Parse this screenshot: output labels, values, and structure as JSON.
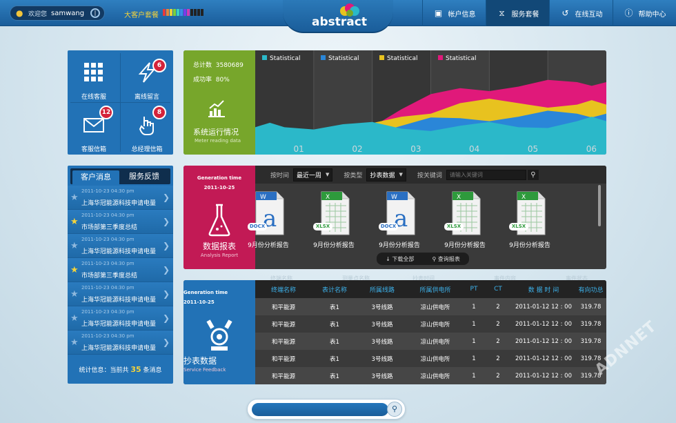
{
  "topbar": {
    "welcome": "欢迎您",
    "username": "samwang",
    "package_label": "大客户套餐",
    "package_level_colors": [
      "#e83a3a",
      "#e8893a",
      "#e8d33a",
      "#7bd13a",
      "#3ad1c1",
      "#3a8ce8",
      "#7b3ae8",
      "#d13ab4",
      "#222222",
      "#222222",
      "#222222",
      "#222222"
    ],
    "logo": "abstract",
    "nav": [
      {
        "label": "帐户信息",
        "icon": "chat-icon"
      },
      {
        "label": "服务套餐",
        "icon": "rss-icon"
      },
      {
        "label": "在线互动",
        "icon": "history-icon"
      },
      {
        "label": "帮助中心",
        "icon": "info-icon"
      }
    ]
  },
  "tiles": [
    {
      "label": "在线客服",
      "icon": "grid-icon",
      "badge": ""
    },
    {
      "label": "离线留言",
      "icon": "lightning-icon",
      "badge": "6"
    },
    {
      "label": "客服信箱",
      "icon": "mail-icon",
      "badge": "12"
    },
    {
      "label": "总经理信箱",
      "icon": "hand-icon",
      "badge": "8"
    }
  ],
  "stats": {
    "total_label": "总计数",
    "total_value": "3580689",
    "success_label": "成功率",
    "success_value": "80%",
    "title": "系统运行情况",
    "subtitle": "Meter reading data"
  },
  "chart_data": {
    "type": "area",
    "legend": [
      {
        "name": "Statistical",
        "color": "#2bb8c9"
      },
      {
        "name": "Statistical",
        "color": "#2a86d8"
      },
      {
        "name": "Statistical",
        "color": "#e8c21f"
      },
      {
        "name": "Statistical",
        "color": "#e0197a"
      }
    ],
    "x": [
      "01",
      "02",
      "03",
      "04",
      "05",
      "06"
    ],
    "series": [
      {
        "name": "Statistical",
        "color": "#e0197a",
        "values": [
          0,
          5,
          42,
          70,
          72,
          78
        ]
      },
      {
        "name": "Statistical",
        "color": "#e8c21f",
        "values": [
          0,
          3,
          32,
          50,
          50,
          48
        ]
      },
      {
        "name": "Statistical",
        "color": "#2a86d8",
        "values": [
          0,
          8,
          20,
          30,
          32,
          36
        ]
      },
      {
        "name": "Statistical",
        "color": "#2bb8c9",
        "values": [
          18,
          22,
          16,
          20,
          18,
          26
        ]
      }
    ],
    "ylim": [
      0,
      100
    ]
  },
  "messages": {
    "tabs": [
      "客户消息",
      "服务反馈"
    ],
    "items": [
      {
        "time": "2011-10-23   04:30 pm",
        "text": "上海华冠能源科技申请电量",
        "starred": false
      },
      {
        "time": "2011-10-23   04:30 pm",
        "text": "市场部第三季度总结",
        "starred": true
      },
      {
        "time": "2011-10-23   04:30 pm",
        "text": "上海华冠能源科技申请电量",
        "starred": false
      },
      {
        "time": "2011-10-23   04:30 pm",
        "text": "市场部第三季度总结",
        "starred": true
      },
      {
        "time": "2011-10-23   04:30 pm",
        "text": "上海华冠能源科技申请电量",
        "starred": false
      },
      {
        "time": "2011-10-23   04:30 pm",
        "text": "上海华冠能源科技申请电量",
        "starred": false
      },
      {
        "time": "2011-10-23   04:30 pm",
        "text": "上海华冠能源科技申请电量",
        "starred": false
      }
    ],
    "footer_prefix": "统计信息：当前共",
    "footer_count": "35",
    "footer_suffix": "条消息"
  },
  "report": {
    "gen_label": "Generation time",
    "gen_date": "2011-10-25",
    "title": "数据报表",
    "subtitle": "Analysis Report",
    "filter_time_label": "按时间",
    "filter_time_value": "最近一周",
    "filter_type_label": "按类型",
    "filter_type_value": "抄表数据",
    "filter_kw_label": "按关键词",
    "filter_kw_placeholder": "请输入关键词",
    "docs": [
      {
        "type": "DOCX",
        "label": "9月份分析报告"
      },
      {
        "type": "XLSX",
        "label": "9月份分析报告"
      },
      {
        "type": "DOCX",
        "label": "9月份分析报告"
      },
      {
        "type": "XLSX",
        "label": "9月份分析报告"
      },
      {
        "type": "XLSX",
        "label": "9月份分析报告"
      }
    ],
    "download_all": "下载全部",
    "query_report": "查询报表"
  },
  "meter": {
    "gen_label": "Generation time",
    "gen_date": "2011-10-25",
    "title": "抄表数据",
    "subtitle": "Service Feedback",
    "ghost_headers": [
      "终端名称",
      "测量点名称",
      "抄表时间",
      "事件内容",
      "事件状态"
    ],
    "columns": [
      "终端名称",
      "表计名称",
      "所属线路",
      "所属供电所",
      "PT",
      "CT",
      "数 据 时 间",
      "有向功总"
    ],
    "rows": [
      [
        "和平能源",
        "表1",
        "3号线路",
        "凉山供电所",
        "1",
        "2",
        "2011-01-12 12 : 00",
        "319.78"
      ],
      [
        "和平能源",
        "表1",
        "3号线路",
        "凉山供电所",
        "1",
        "2",
        "2011-01-12 12 : 00",
        "319.78"
      ],
      [
        "和平能源",
        "表1",
        "3号线路",
        "凉山供电所",
        "1",
        "2",
        "2011-01-12 12 : 00",
        "319.78"
      ],
      [
        "和平能源",
        "表1",
        "3号线路",
        "凉山供电所",
        "1",
        "2",
        "2011-01-12 12 : 00",
        "319.78"
      ],
      [
        "和平能源",
        "表1",
        "3号线路",
        "凉山供电所",
        "1",
        "2",
        "2011-01-12 12 : 00",
        "319.78"
      ]
    ]
  },
  "watermark": "ADNNET"
}
